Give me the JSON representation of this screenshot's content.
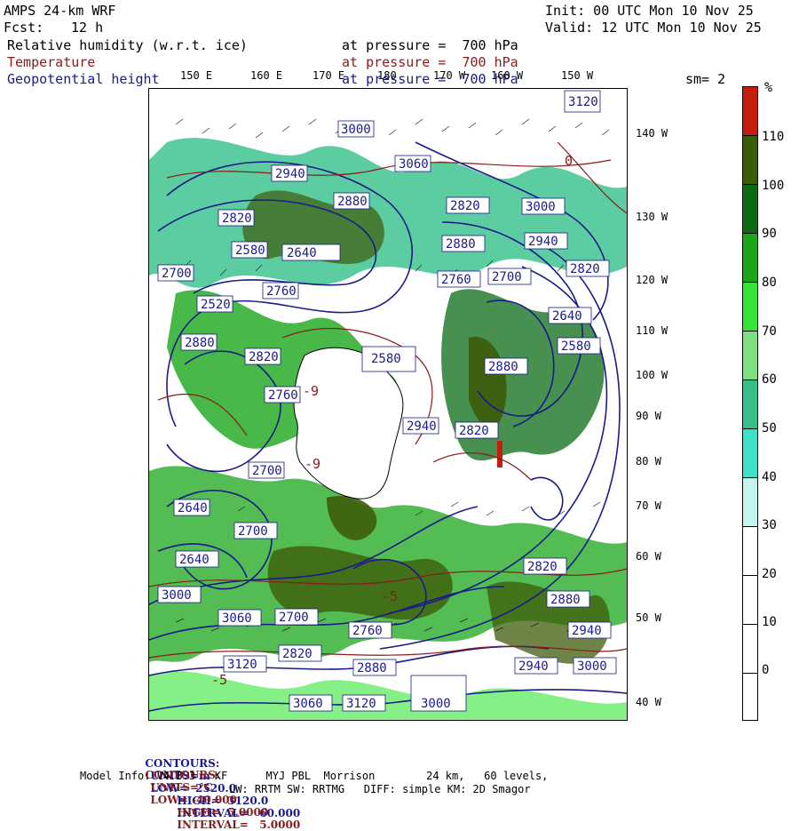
{
  "header": {
    "model": "AMPS 24-km WRF",
    "init": "Init: 00 UTC Mon 10 Nov 25",
    "fcst_label": "Fcst:",
    "fcst_value": "12 h",
    "valid": "Valid: 12 UTC Mon 10 Nov 25"
  },
  "fields": [
    {
      "name": "Relative humidity (w.r.t. ice)",
      "level": "at pressure =  700 hPa",
      "color": "#000000"
    },
    {
      "name": "Temperature",
      "level": "at pressure =  700 hPa",
      "color": "#8b1a1a"
    },
    {
      "name": "Geopotential height",
      "level": "at pressure =  700 hPa",
      "color": "#1a1a8b"
    }
  ],
  "smoothing": "sm= 2",
  "top_longitudes": [
    "150 E",
    "160 E",
    "170 E",
    "180",
    "170 W",
    "160 W",
    "150 W"
  ],
  "right_longitudes": [
    "140 W",
    "130 W",
    "120 W",
    "110 W",
    "100 W",
    "90 W",
    "80 W",
    "70 W",
    "60 W",
    "50 W",
    "40 W"
  ],
  "colorbar": {
    "unit": "%",
    "labels": [
      "110",
      "100",
      "90",
      "80",
      "70",
      "60",
      "50",
      "40",
      "30",
      "20",
      "10",
      "0"
    ],
    "colors": [
      "#c41e0e",
      "#3d5c0a",
      "#0a6b14",
      "#1aa61a",
      "#33e633",
      "#7ddf7d",
      "#33c08a",
      "#3fe0c8",
      "#c2f5ec",
      "#ffffff",
      "#ffffff",
      "#ffffff",
      "#ffffff"
    ]
  },
  "contour_labels": [
    "3120",
    "3000",
    "3060",
    "2940",
    "2880",
    "2820",
    "2580",
    "2640",
    "2700",
    "2760",
    "2520",
    "2880",
    "2820",
    "2760",
    "2700",
    "2640",
    "2580",
    "2820",
    "3000",
    "2940",
    "2880",
    "2820",
    "2760",
    "2700",
    "2640",
    "2580",
    "2880",
    "2820",
    "2940",
    "3000",
    "3060",
    "3120",
    "2700",
    "2640",
    "2760",
    "2700",
    "2820",
    "2880",
    "2940",
    "3000",
    "3060",
    "3120",
    "3000",
    "2940",
    "2880",
    "2820"
  ],
  "temp_labels": [
    "-9",
    "-9",
    "0",
    "-5",
    "-5"
  ],
  "footer": {
    "line1": {
      "label": "CONTOURS:",
      "units": "UNITS=m",
      "low": "LOW=  2520.0",
      "high": "HIGH=  3120.0",
      "interval": "INTERVAL=   60.000"
    },
    "line2": {
      "label": "CONTOURS:",
      "units": "UNITS=°C",
      "low": "LOW= -40.000",
      "high": "HIGH=  5.0000",
      "interval": "INTERVAL=   5.0000"
    },
    "line3": "Model Info: V4.3.3   KF      MYJ PBL  Morrison        24 km,   60 levels,",
    "line4": "LW: RRTM SW: RRTMG   DIFF: simple KM: 2D Smagor"
  }
}
